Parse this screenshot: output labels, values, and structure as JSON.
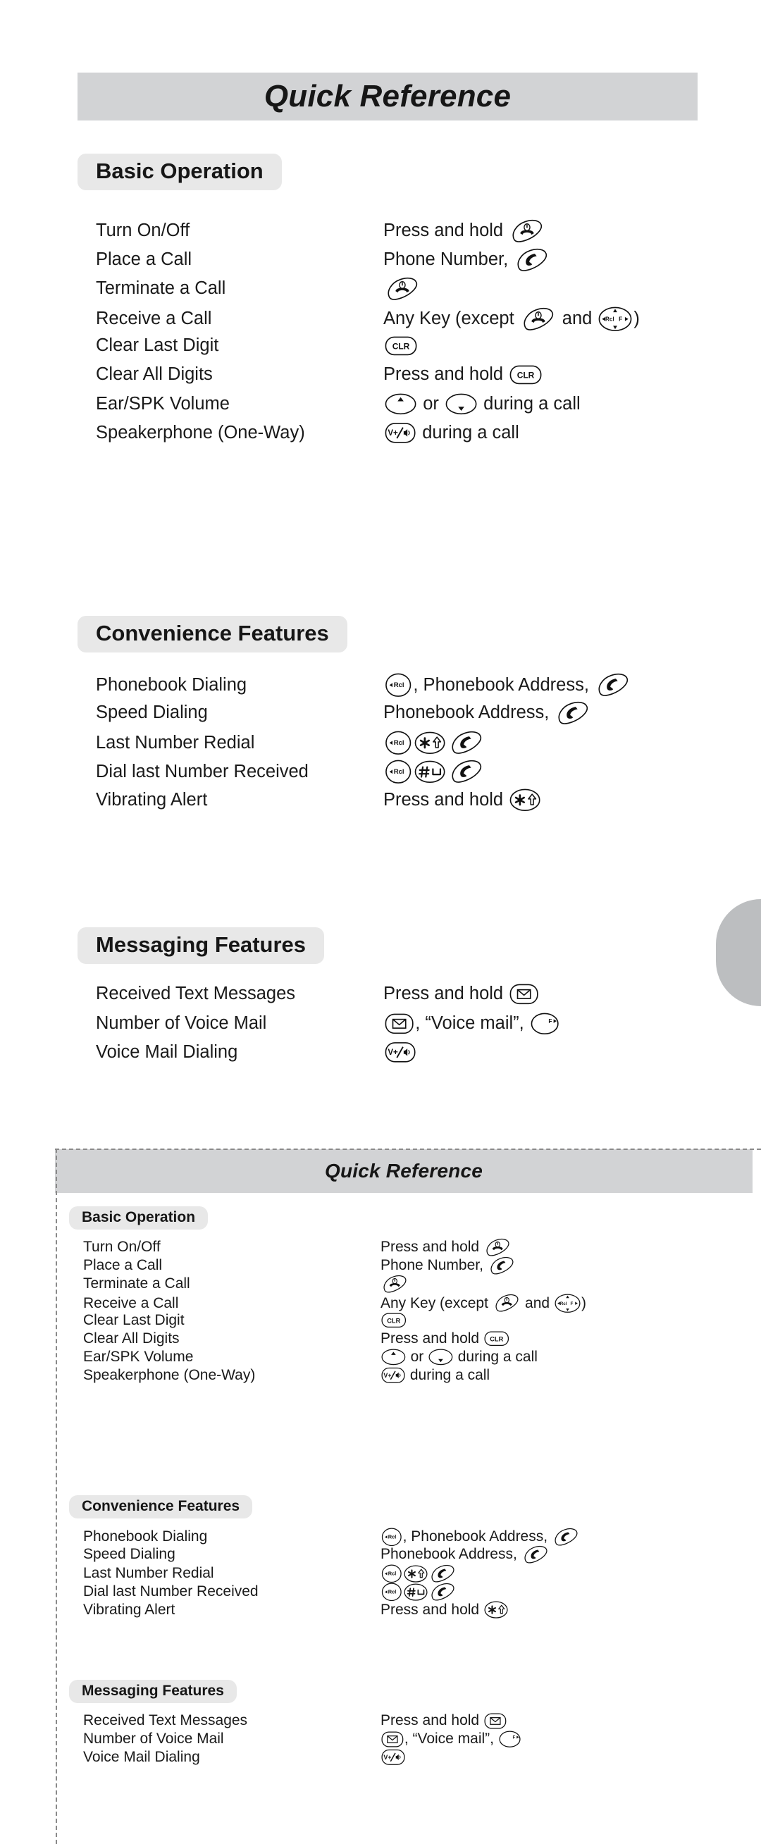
{
  "document": {
    "title": "Quick Reference",
    "colors": {
      "banner_gray": "#d2d3d5",
      "section_pill_gray": "#e8e8e8",
      "thumb_tab_gray": "#bcbec0",
      "text_black": "#1a1a1a",
      "cut_line_gray": "#8a8a8a"
    }
  },
  "sections": [
    {
      "id": "basic-operation",
      "heading": "Basic Operation",
      "rows": [
        {
          "label": "Turn On/Off",
          "parts": [
            {
              "t": "text",
              "v": "Press and hold "
            },
            {
              "t": "key",
              "v": "end-power-key"
            }
          ]
        },
        {
          "label": "Place a Call",
          "parts": [
            {
              "t": "text",
              "v": "Phone Number, "
            },
            {
              "t": "key",
              "v": "send-key"
            }
          ]
        },
        {
          "label": "Terminate a Call",
          "parts": [
            {
              "t": "key",
              "v": "end-power-key"
            }
          ]
        },
        {
          "label": "Receive a Call",
          "parts": [
            {
              "t": "text",
              "v": "Any Key (except "
            },
            {
              "t": "key",
              "v": "end-power-key"
            },
            {
              "t": "text",
              "v": " and "
            },
            {
              "t": "key",
              "v": "navigation-key"
            },
            {
              "t": "text",
              "v": ")"
            }
          ]
        },
        {
          "label": "Clear Last Digit",
          "parts": [
            {
              "t": "key",
              "v": "clr-key"
            }
          ]
        },
        {
          "label": "Clear All Digits",
          "parts": [
            {
              "t": "text",
              "v": "Press and hold "
            },
            {
              "t": "key",
              "v": "clr-key"
            }
          ]
        },
        {
          "label": "Ear/SPK Volume",
          "parts": [
            {
              "t": "key",
              "v": "volume-up-key"
            },
            {
              "t": "text",
              "v": " or "
            },
            {
              "t": "key",
              "v": "volume-down-key"
            },
            {
              "t": "text",
              "v": " during a call"
            }
          ]
        },
        {
          "label": "Speakerphone (One-Way)",
          "parts": [
            {
              "t": "key",
              "v": "speakerphone-key"
            },
            {
              "t": "text",
              "v": " during a call"
            }
          ]
        }
      ]
    },
    {
      "id": "convenience-features",
      "heading": "Convenience Features",
      "rows": [
        {
          "label": "Phonebook Dialing",
          "parts": [
            {
              "t": "key",
              "v": "rcl-key"
            },
            {
              "t": "text",
              "v": ", Phonebook Address, "
            },
            {
              "t": "key",
              "v": "send-key"
            }
          ]
        },
        {
          "label": "Speed Dialing",
          "parts": [
            {
              "t": "text",
              "v": "Phonebook Address, "
            },
            {
              "t": "key",
              "v": "send-key"
            }
          ]
        },
        {
          "label": "Last Number Redial",
          "parts": [
            {
              "t": "key",
              "v": "rcl-key"
            },
            {
              "t": "key",
              "v": "star-shift-key"
            },
            {
              "t": "key",
              "v": "send-key"
            }
          ]
        },
        {
          "label": "Dial last Number Received",
          "parts": [
            {
              "t": "key",
              "v": "rcl-key"
            },
            {
              "t": "key",
              "v": "pound-space-key"
            },
            {
              "t": "key",
              "v": "send-key"
            }
          ]
        },
        {
          "label": "Vibrating Alert",
          "parts": [
            {
              "t": "text",
              "v": "Press and hold "
            },
            {
              "t": "key",
              "v": "star-shift-key"
            }
          ]
        }
      ]
    },
    {
      "id": "messaging-features",
      "heading": "Messaging Features",
      "rows": [
        {
          "label": "Received Text Messages",
          "parts": [
            {
              "t": "text",
              "v": "Press and hold "
            },
            {
              "t": "key",
              "v": "message-envelope-key"
            }
          ]
        },
        {
          "label": "Number of Voice Mail",
          "parts": [
            {
              "t": "key",
              "v": "message-envelope-key"
            },
            {
              "t": "text",
              "v": ", “Voice mail”, "
            },
            {
              "t": "key",
              "v": "f-right-key"
            }
          ]
        },
        {
          "label": "Voice Mail Dialing",
          "parts": [
            {
              "t": "key",
              "v": "speakerphone-key"
            }
          ]
        }
      ]
    }
  ],
  "keys": {
    "end-power-key": {
      "name": "end-power-key",
      "label": ""
    },
    "send-key": {
      "name": "send-key",
      "label": ""
    },
    "navigation-key": {
      "name": "navigation-key",
      "label": "Rcl  F"
    },
    "clr-key": {
      "name": "clr-key",
      "label": "CLR"
    },
    "volume-up-key": {
      "name": "volume-up-key",
      "label": ""
    },
    "volume-down-key": {
      "name": "volume-down-key",
      "label": ""
    },
    "speakerphone-key": {
      "name": "speakerphone-key",
      "label": "V+/"
    },
    "rcl-key": {
      "name": "rcl-key",
      "label": "Rcl"
    },
    "star-shift-key": {
      "name": "star-shift-key",
      "label": ""
    },
    "pound-space-key": {
      "name": "pound-space-key",
      "label": ""
    },
    "message-envelope-key": {
      "name": "message-envelope-key",
      "label": ""
    },
    "f-right-key": {
      "name": "f-right-key",
      "label": "F"
    }
  },
  "layout": {
    "big": {
      "section_head_pos": [
        {
          "l": 110,
          "t": 218
        },
        {
          "l": 110,
          "t": 874
        },
        {
          "l": 110,
          "t": 1316
        }
      ],
      "rows_top": [
        312,
        353,
        394,
        435,
        476,
        517,
        558,
        599,
        955,
        996,
        1037,
        1078,
        1119,
        1396,
        1437,
        1478
      ],
      "label_left": 136,
      "value_left": 544
    },
    "small": {
      "section_head_pos": [
        {
          "l": 98,
          "t": 1712
        },
        {
          "l": 98,
          "t": 2122
        },
        {
          "l": 98,
          "t": 2384
        }
      ],
      "rows_top": [
        1758,
        1784,
        1810,
        1836,
        1862,
        1888,
        1914,
        1940,
        2168,
        2194,
        2220,
        2246,
        2272,
        2430,
        2456,
        2482
      ],
      "label_left": 118,
      "value_left": 540
    }
  }
}
